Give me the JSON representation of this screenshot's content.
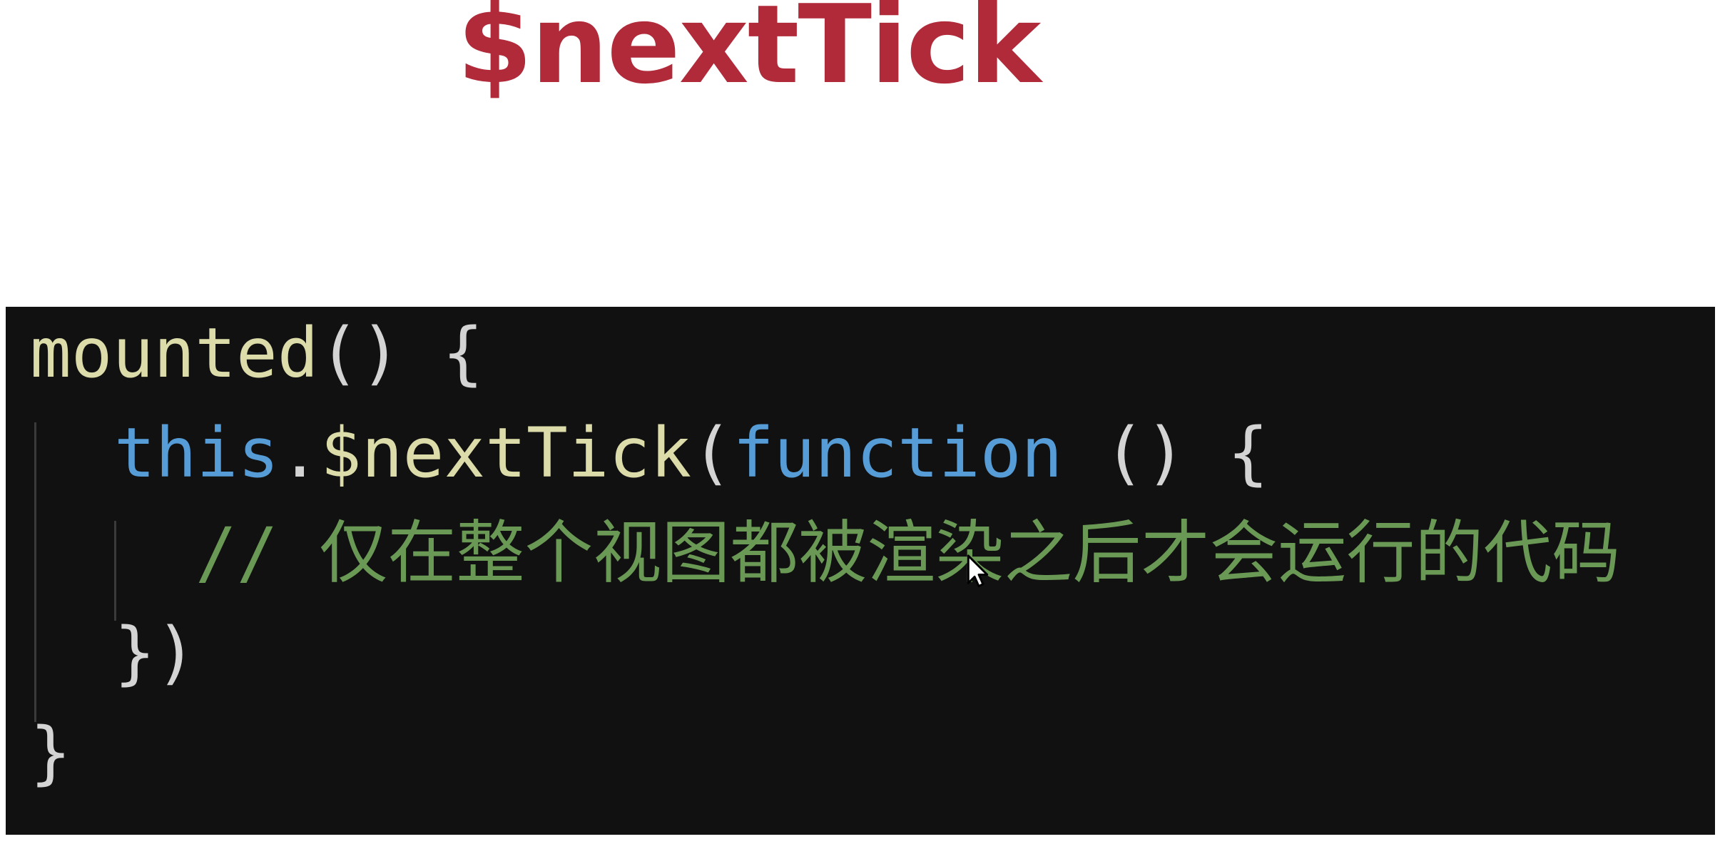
{
  "title": "$nextTick",
  "code": {
    "line1": {
      "fn": "mounted",
      "rest": "() {"
    },
    "line2": {
      "this": "this",
      "dot": ".",
      "method": "$nextTick",
      "open": "(",
      "kw": "function",
      "rest": " () {"
    },
    "line3": {
      "comment": "// 仅在整个视图都被渲染之后才会运行的代码"
    },
    "line4": {
      "text": "})"
    },
    "line5": {
      "text": "}"
    }
  },
  "colors": {
    "title": "#b02a3a",
    "background": "#111111",
    "function_name": "#dcdcaa",
    "keyword": "#569cd6",
    "comment": "#6a9955",
    "punctuation": "#d4d4d4"
  }
}
